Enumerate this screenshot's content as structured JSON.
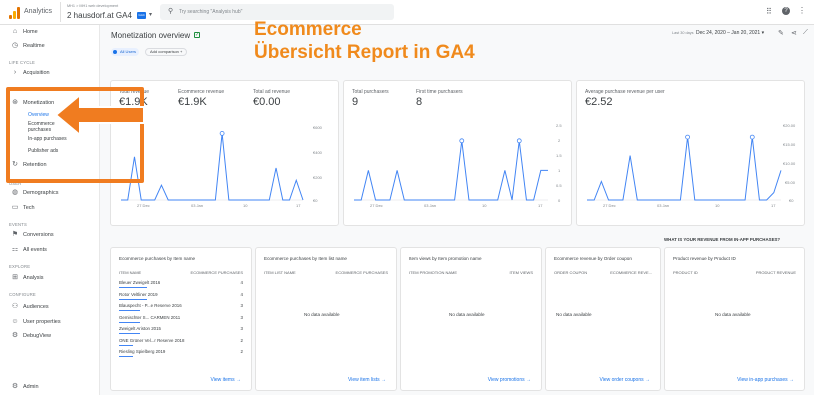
{
  "app": {
    "name": "Analytics",
    "account_line": "MH1 > MH1 web development",
    "property": "2 hausdorf.at GA4",
    "badge": "GA4",
    "search_placeholder": "Try searching \"Analysis hub\""
  },
  "colors": {
    "accent": "#1a73e8",
    "line": "#4285f4",
    "highlight": "#f07c20",
    "overlay_text": "#f08a1c"
  },
  "overlay": {
    "line1": "Ecommerce",
    "line2": "Übersicht Report in GA4"
  },
  "sidebar": {
    "items": [
      {
        "label": "Home",
        "icon": "home-icon"
      },
      {
        "label": "Realtime",
        "icon": "clock-icon"
      }
    ],
    "life_cycle_label": "LIFE CYCLE",
    "acquisition": "Acquisition",
    "monetization": "Monetization",
    "sub_items": [
      "Overview",
      "Ecommerce purchases",
      "In-app purchases",
      "Publisher ads"
    ],
    "retention": "Retention",
    "user_label": "USER",
    "demographics": "Demographics",
    "tech": "Tech",
    "events_label": "EVENTS",
    "conversions": "Conversions",
    "all_events": "All events",
    "explore_label": "EXPLORE",
    "analysis": "Analysis",
    "configure_label": "CONFIGURE",
    "audiences": "Audiences",
    "user_properties": "User properties",
    "debugview": "DebugView",
    "admin": "Admin"
  },
  "header": {
    "title": "Monetization overview",
    "filter_chip": "All Users",
    "add_comparison": "Add comparison +",
    "date_label": "Last 30 days",
    "date_range": "Dec 24, 2020 – Jan 20, 2021"
  },
  "cards": [
    {
      "metrics": [
        {
          "label": "Total revenue",
          "value": "€1.9K"
        },
        {
          "label": "Ecommerce revenue",
          "value": "€1.9K"
        },
        {
          "label": "Total ad revenue",
          "value": "€0.00"
        }
      ],
      "y_ticks": [
        "€600",
        "€400",
        "€200",
        "€0"
      ],
      "x_ticks": [
        "27 Dec",
        "03 Jan",
        "10",
        "17"
      ]
    },
    {
      "metrics": [
        {
          "label": "Total purchasers",
          "value": "9"
        },
        {
          "label": "First time purchasers",
          "value": "8"
        }
      ],
      "y_ticks": [
        "2.5",
        "2",
        "1.5",
        "1",
        "0.5",
        "0"
      ],
      "x_ticks": [
        "27 Dec",
        "03 Jan",
        "10",
        "17"
      ]
    },
    {
      "metrics": [
        {
          "label": "Average purchase revenue per user",
          "value": "€2.52"
        }
      ],
      "y_ticks": [
        "€20.00",
        "€15.00",
        "€10.00",
        "€5.00",
        "€0"
      ],
      "x_ticks": [
        "27 Dec",
        "03 Jan",
        "10",
        "17"
      ]
    }
  ],
  "chart_data": [
    {
      "type": "line",
      "x": [
        "Dec 24",
        "Dec 25",
        "Dec 26",
        "Dec 27",
        "Dec 28",
        "Dec 29",
        "Dec 30",
        "Dec 31",
        "Jan 1",
        "Jan 2",
        "Jan 3",
        "Jan 4",
        "Jan 5",
        "Jan 6",
        "Jan 7",
        "Jan 8",
        "Jan 9",
        "Jan 10",
        "Jan 11",
        "Jan 12",
        "Jan 13",
        "Jan 14",
        "Jan 15",
        "Jan 16",
        "Jan 17",
        "Jan 18",
        "Jan 19",
        "Jan 20"
      ],
      "series": [
        {
          "values": [
            0,
            0,
            350,
            0,
            0,
            0,
            120,
            0,
            0,
            0,
            0,
            0,
            0,
            0,
            0,
            540,
            0,
            0,
            0,
            0,
            0,
            0,
            0,
            260,
            0,
            0,
            160,
            0
          ]
        }
      ],
      "ylim": [
        0,
        600
      ]
    },
    {
      "type": "line",
      "x": [
        "Dec 24",
        "Dec 25",
        "Dec 26",
        "Dec 27",
        "Dec 28",
        "Dec 29",
        "Dec 30",
        "Dec 31",
        "Jan 1",
        "Jan 2",
        "Jan 3",
        "Jan 4",
        "Jan 5",
        "Jan 6",
        "Jan 7",
        "Jan 8",
        "Jan 9",
        "Jan 10",
        "Jan 11",
        "Jan 12",
        "Jan 13",
        "Jan 14",
        "Jan 15",
        "Jan 16",
        "Jan 17",
        "Jan 18",
        "Jan 19",
        "Jan 20"
      ],
      "series": [
        {
          "values": [
            0,
            0,
            1,
            0,
            0,
            0,
            1,
            0,
            0,
            0,
            0,
            0,
            0,
            0,
            0,
            2,
            0,
            0,
            0,
            0,
            0,
            1,
            0,
            2,
            0,
            0,
            1,
            1
          ]
        }
      ],
      "ylim": [
        0,
        2.5
      ]
    },
    {
      "type": "line",
      "x": [
        "Dec 24",
        "Dec 25",
        "Dec 26",
        "Dec 27",
        "Dec 28",
        "Dec 29",
        "Dec 30",
        "Dec 31",
        "Jan 1",
        "Jan 2",
        "Jan 3",
        "Jan 4",
        "Jan 5",
        "Jan 6",
        "Jan 7",
        "Jan 8",
        "Jan 9",
        "Jan 10",
        "Jan 11",
        "Jan 12",
        "Jan 13",
        "Jan 14",
        "Jan 15",
        "Jan 16",
        "Jan 17",
        "Jan 18",
        "Jan 19",
        "Jan 20"
      ],
      "series": [
        {
          "values": [
            0,
            0,
            5,
            0,
            0,
            0,
            12,
            0,
            0,
            0,
            0,
            0,
            0,
            0,
            17,
            0,
            0,
            0,
            0,
            0,
            0,
            0,
            0,
            17,
            0,
            0,
            2,
            8
          ]
        }
      ],
      "ylim": [
        0,
        20
      ]
    }
  ],
  "tables": {
    "question": "WHAT IS YOUR REVENUE FROM IN-APP PURCHASES?",
    "items": {
      "title": "Ecommerce purchases by Item name",
      "col1": "ITEM NAME",
      "col2": "ECOMMERCE PURCHASES",
      "rows": [
        {
          "name": "Bleuer Zweigelt 2016",
          "value": "4",
          "share": 1.0
        },
        {
          "name": "Rotor Veltliner 2019",
          "value": "4",
          "share": 1.0
        },
        {
          "name": "Blauspecht - P...e Reserve 2016",
          "value": "3",
          "share": 0.75
        },
        {
          "name": "Gemischter S... CARMEN 2011",
          "value": "3",
          "share": 0.75
        },
        {
          "name": "Zweigelt Ariston 2015",
          "value": "3",
          "share": 0.75
        },
        {
          "name": "ONE Grüner Vel...r Reserve 2018",
          "value": "2",
          "share": 0.5
        },
        {
          "name": "Riesling Spielberg 2019",
          "value": "2",
          "share": 0.5
        }
      ],
      "link": "View items →"
    },
    "list": {
      "title": "Ecommerce purchases by Item list name",
      "col1": "ITEM LIST NAME",
      "col2": "ECOMMERCE PURCHASES",
      "empty": "No data available",
      "link": "View item lists →"
    },
    "promo": {
      "title": "Item views by Item promotion name",
      "col1": "ITEM PROMOTION NAME",
      "col2": "ITEM VIEWS",
      "empty": "No data available",
      "link": "View promotions →"
    },
    "coupon": {
      "title": "Ecommerce revenue by Order coupon",
      "col1": "ORDER COUPON",
      "col2": "ECOMMERCE REVE...",
      "empty": "No data available",
      "link": "View order coupons →"
    },
    "product": {
      "title": "Product revenue by Product ID",
      "col1": "PRODUCT ID",
      "col2": "PRODUCT REVENUE",
      "empty": "No data available",
      "link": "View in-app purchases →"
    }
  }
}
